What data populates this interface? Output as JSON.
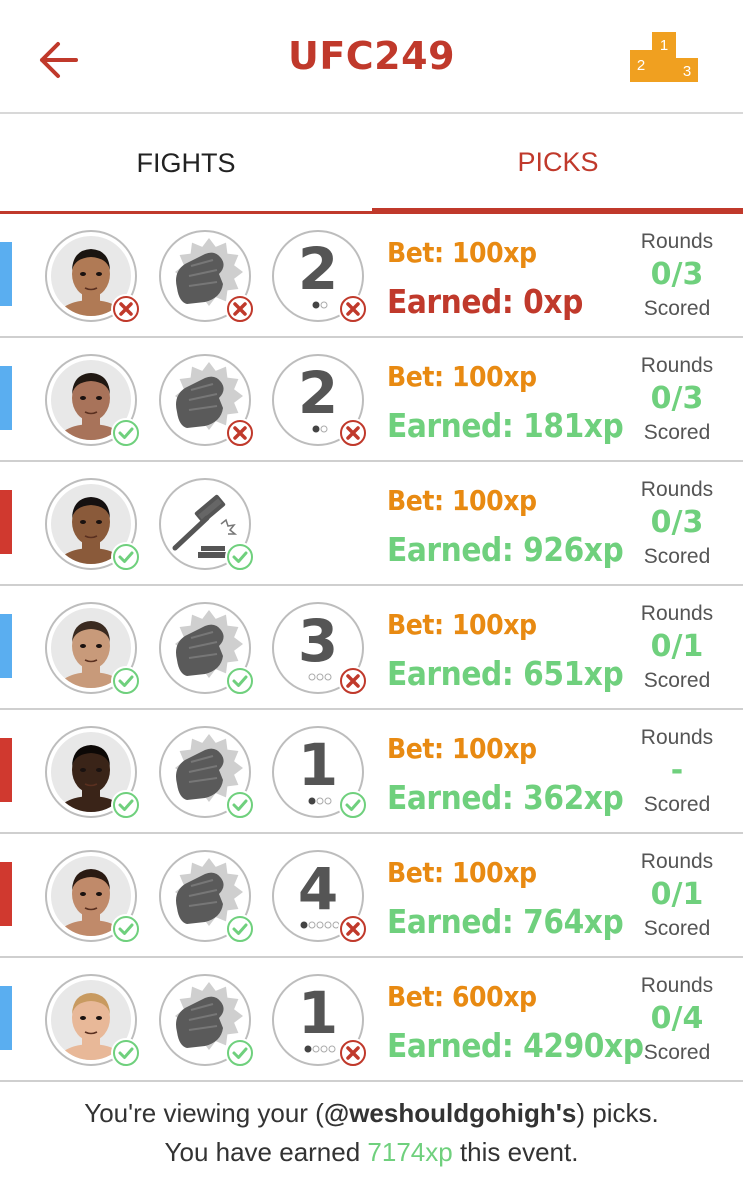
{
  "header": {
    "title": "UFC249",
    "podium_ranks": [
      "1",
      "2",
      "3"
    ]
  },
  "tabs": [
    {
      "label": "FIGHTS"
    },
    {
      "label": "PICKS"
    }
  ],
  "colors": {
    "accent": "#c0392b",
    "bet": "#e88a12",
    "win": "#6fd07d",
    "blue_corner": "#5aaef0",
    "red_corner": "#d0392f"
  },
  "picks": [
    {
      "corner": "blue",
      "fighter_correct": false,
      "method": "ko",
      "method_correct": false,
      "round": "2",
      "round_dots": 2,
      "round_filled": 1,
      "round_correct": false,
      "bet": "Bet: 100xp",
      "earned": "Earned: 0xp",
      "earned_win": false,
      "rounds_label": "Rounds",
      "rounds_value": "0/3",
      "scored_label": "Scored"
    },
    {
      "corner": "blue",
      "fighter_correct": true,
      "method": "ko",
      "method_correct": false,
      "round": "2",
      "round_dots": 2,
      "round_filled": 1,
      "round_correct": false,
      "bet": "Bet: 100xp",
      "earned": "Earned: 181xp",
      "earned_win": true,
      "rounds_label": "Rounds",
      "rounds_value": "0/3",
      "scored_label": "Scored"
    },
    {
      "corner": "red",
      "fighter_correct": true,
      "method": "decision",
      "method_correct": true,
      "round": "",
      "round_dots": 0,
      "round_filled": 0,
      "round_correct": null,
      "bet": "Bet: 100xp",
      "earned": "Earned: 926xp",
      "earned_win": true,
      "rounds_label": "Rounds",
      "rounds_value": "0/3",
      "scored_label": "Scored"
    },
    {
      "corner": "blue",
      "fighter_correct": true,
      "method": "ko",
      "method_correct": true,
      "round": "3",
      "round_dots": 3,
      "round_filled": 0,
      "round_correct": false,
      "bet": "Bet: 100xp",
      "earned": "Earned: 651xp",
      "earned_win": true,
      "rounds_label": "Rounds",
      "rounds_value": "0/1",
      "scored_label": "Scored"
    },
    {
      "corner": "red",
      "fighter_correct": true,
      "method": "ko",
      "method_correct": true,
      "round": "1",
      "round_dots": 3,
      "round_filled": 1,
      "round_correct": true,
      "bet": "Bet: 100xp",
      "earned": "Earned: 362xp",
      "earned_win": true,
      "rounds_label": "Rounds",
      "rounds_value": "-",
      "scored_label": "Scored"
    },
    {
      "corner": "red",
      "fighter_correct": true,
      "method": "ko",
      "method_correct": true,
      "round": "4",
      "round_dots": 5,
      "round_filled": 1,
      "round_correct": false,
      "bet": "Bet: 100xp",
      "earned": "Earned: 764xp",
      "earned_win": true,
      "rounds_label": "Rounds",
      "rounds_value": "0/1",
      "scored_label": "Scored"
    },
    {
      "corner": "blue",
      "fighter_correct": true,
      "method": "ko",
      "method_correct": true,
      "round": "1",
      "round_dots": 4,
      "round_filled": 1,
      "round_correct": false,
      "bet": "Bet: 600xp",
      "earned": "Earned: 4290xp",
      "earned_win": true,
      "rounds_label": "Rounds",
      "rounds_value": "0/4",
      "scored_label": "Scored"
    }
  ],
  "footer": {
    "line1_pre": "You're viewing your (",
    "handle": "@weshouldgohigh's",
    "line1_post": ") picks.",
    "line2_pre": "You have earned ",
    "total_xp": "7174xp",
    "line2_post": " this event."
  }
}
